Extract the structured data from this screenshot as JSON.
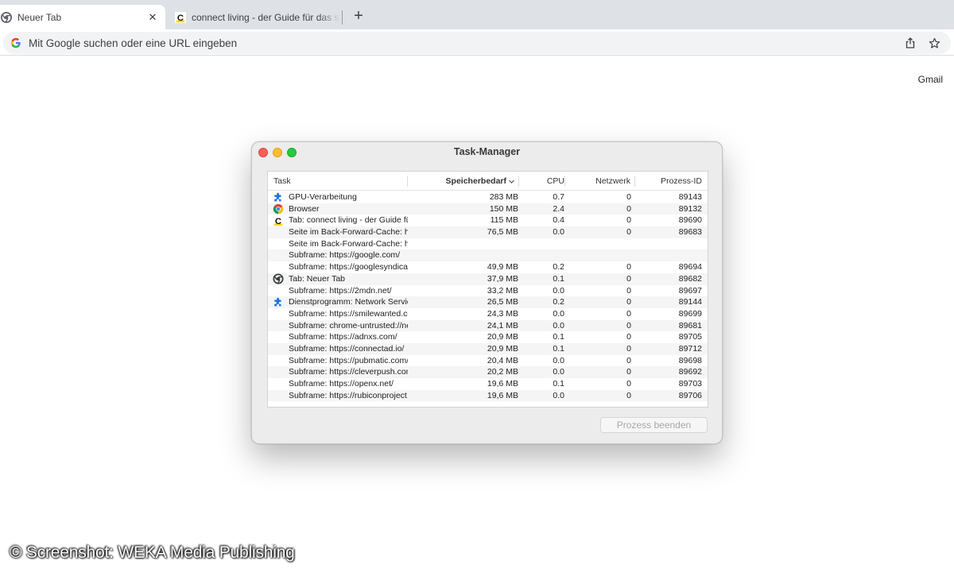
{
  "browser": {
    "tabs": [
      {
        "label": "Neuer Tab",
        "icon": "chrome-icon",
        "active": true
      },
      {
        "label": "connect living - der Guide für das smarte Leben",
        "icon": "connect-living-icon",
        "active": false
      }
    ],
    "new_tab_label": "+",
    "omnibox": {
      "placeholder": "Mit Google suchen oder eine URL eingeben",
      "icons": [
        "google-g-icon",
        "share-icon",
        "star-icon"
      ]
    },
    "gmail_link": "Gmail"
  },
  "task_manager": {
    "title": "Task-Manager",
    "columns": {
      "task": "Task",
      "memory": "Speicherbedarf",
      "cpu": "CPU",
      "network": "Netzwerk",
      "pid": "Prozess-ID"
    },
    "sorted_column": "memory",
    "rows": [
      {
        "icon": "puzzle",
        "task": "GPU-Verarbeitung",
        "memory": "283 MB",
        "cpu": "0.7",
        "network": "0",
        "pid": "89143"
      },
      {
        "icon": "chrome-color",
        "task": "Browser",
        "memory": "150 MB",
        "cpu": "2.4",
        "network": "0",
        "pid": "89132"
      },
      {
        "icon": "connect-living",
        "task": "Tab: connect living - der Guide für das smarte Leben",
        "memory": "115 MB",
        "cpu": "0.4",
        "network": "0",
        "pid": "89690"
      },
      {
        "icon": "",
        "task": "Seite im Back-Forward-Cache: https://www.connect-living.de/",
        "memory": "76,5 MB",
        "cpu": "0.0",
        "network": "0",
        "pid": "89683"
      },
      {
        "icon": "",
        "task": "Seite im Back-Forward-Cache: https://www.connect-living.de/",
        "memory": "",
        "cpu": "",
        "network": "",
        "pid": ""
      },
      {
        "icon": "",
        "task": "Subframe: https://google.com/",
        "memory": "",
        "cpu": "",
        "network": "",
        "pid": ""
      },
      {
        "icon": "",
        "task": "Subframe: https://googlesyndication.com/",
        "memory": "49,9 MB",
        "cpu": "0.2",
        "network": "0",
        "pid": "89694"
      },
      {
        "icon": "chrome-mono",
        "task": "Tab: Neuer Tab",
        "memory": "37,9 MB",
        "cpu": "0.1",
        "network": "0",
        "pid": "89682"
      },
      {
        "icon": "",
        "task": "Subframe: https://2mdn.net/",
        "memory": "33,2 MB",
        "cpu": "0.0",
        "network": "0",
        "pid": "89697"
      },
      {
        "icon": "puzzle",
        "task": "Dienstprogramm: Network Service",
        "memory": "26,5 MB",
        "cpu": "0.2",
        "network": "0",
        "pid": "89144"
      },
      {
        "icon": "",
        "task": "Subframe: https://smilewanted.com/",
        "memory": "24,3 MB",
        "cpu": "0.0",
        "network": "0",
        "pid": "89699"
      },
      {
        "icon": "",
        "task": "Subframe: chrome-untrusted://new-tab-page/",
        "memory": "24,1 MB",
        "cpu": "0.0",
        "network": "0",
        "pid": "89681"
      },
      {
        "icon": "",
        "task": "Subframe: https://adnxs.com/",
        "memory": "20,9 MB",
        "cpu": "0.1",
        "network": "0",
        "pid": "89705"
      },
      {
        "icon": "",
        "task": "Subframe: https://connectad.io/",
        "memory": "20,9 MB",
        "cpu": "0.1",
        "network": "0",
        "pid": "89712"
      },
      {
        "icon": "",
        "task": "Subframe: https://pubmatic.com/",
        "memory": "20,4 MB",
        "cpu": "0.0",
        "network": "0",
        "pid": "89698"
      },
      {
        "icon": "",
        "task": "Subframe: https://cleverpush.com/",
        "memory": "20,2 MB",
        "cpu": "0.0",
        "network": "0",
        "pid": "89692"
      },
      {
        "icon": "",
        "task": "Subframe: https://openx.net/",
        "memory": "19,6 MB",
        "cpu": "0.1",
        "network": "0",
        "pid": "89703"
      },
      {
        "icon": "",
        "task": "Subframe: https://rubiconproject.com/",
        "memory": "19,6 MB",
        "cpu": "0.0",
        "network": "0",
        "pid": "89706"
      }
    ],
    "end_process_button": "Prozess beenden",
    "end_process_enabled": false
  },
  "watermark": "© Screenshot: WEKA Media Publishing",
  "colors": {
    "tabstrip_bg": "#dee1e6",
    "omnibox_bg": "#f1f3f4",
    "window_bg": "#ececec",
    "traffic_red": "#fe5f57",
    "traffic_yellow": "#febc2e",
    "traffic_green": "#28c840",
    "puzzle_icon": "#1a73e8"
  }
}
